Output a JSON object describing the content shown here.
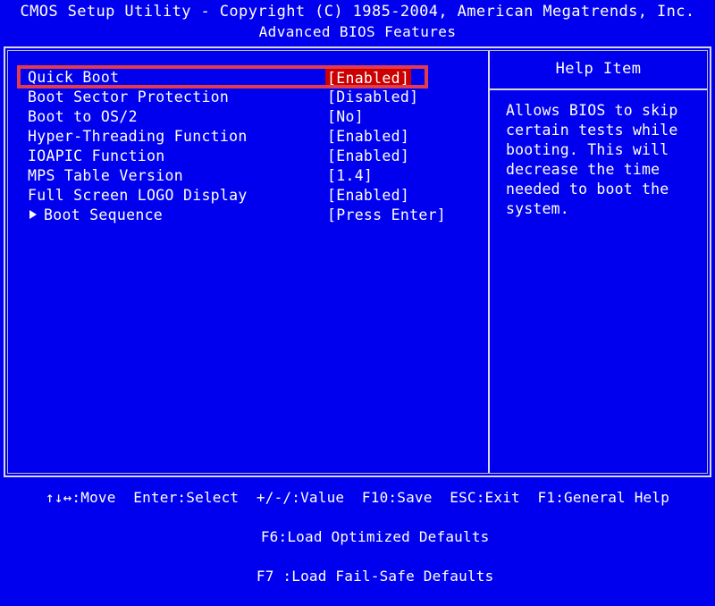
{
  "title": {
    "line1": "CMOS Setup Utility - Copyright (C) 1985-2004, American Megatrends, Inc.",
    "line2": "Advanced BIOS Features"
  },
  "settings": {
    "rows": [
      {
        "label": "Quick Boot",
        "value": "[Enabled]",
        "selected": true,
        "submenu": false
      },
      {
        "label": "Boot Sector Protection",
        "value": "[Disabled]",
        "selected": false,
        "submenu": false
      },
      {
        "label": "Boot to OS/2",
        "value": "[No]",
        "selected": false,
        "submenu": false
      },
      {
        "label": "Hyper-Threading Function",
        "value": "[Enabled]",
        "selected": false,
        "submenu": false
      },
      {
        "label": "IOAPIC Function",
        "value": "[Enabled]",
        "selected": false,
        "submenu": false
      },
      {
        "label": "MPS Table Version",
        "value": "[1.4]",
        "selected": false,
        "submenu": false
      },
      {
        "label": "Full Screen LOGO Display",
        "value": "[Enabled]",
        "selected": false,
        "submenu": false
      },
      {
        "label": "Boot Sequence",
        "value": "[Press Enter]",
        "selected": false,
        "submenu": true
      }
    ]
  },
  "help": {
    "title": "Help Item",
    "text": "Allows BIOS to skip\ncertain tests while\nbooting. This will\ndecrease the time\nneeded to boot the\nsystem."
  },
  "footer": {
    "line1": "↑↓↔:Move  Enter:Select  +/-/:Value  F10:Save  ESC:Exit  F1:General Help",
    "line2_left": "F6:Load Optimized Defaults",
    "line2_right": "F7 :Load Fail-Safe Defaults"
  },
  "colors": {
    "background": "#0000ee",
    "text": "#ffffff",
    "frame": "#d9d9e6",
    "selection": "#cc0000",
    "annotation": "#e23a4e"
  }
}
